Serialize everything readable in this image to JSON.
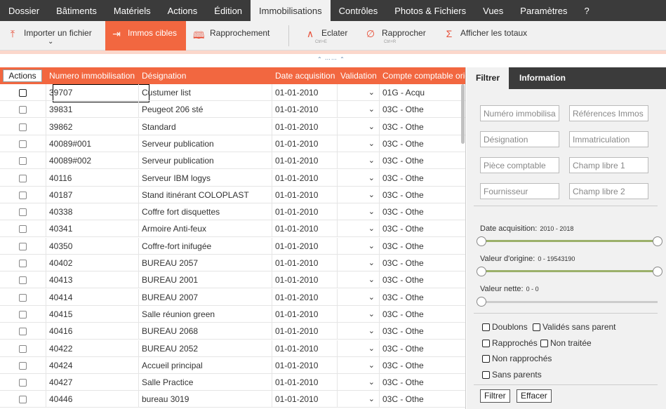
{
  "menu": [
    "Dossier",
    "Bâtiments",
    "Matériels",
    "Actions",
    "Édition",
    "Immobilisations",
    "Contrôles",
    "Photos & Fichiers",
    "Vues",
    "Paramètres",
    "?"
  ],
  "toolbar": {
    "import": "Importer un fichier",
    "immos_cibles": "Immos cibles",
    "rapprochement": "Rapprochement",
    "eclater": "Eclater",
    "eclater_shortcut": "Ctrl+E",
    "rapprocher": "Rapprocher",
    "rapprocher_shortcut": "Ctrl+R",
    "afficher_totaux": "Afficher les totaux"
  },
  "grid": {
    "actions_label": "Actions",
    "headers": {
      "numero": "Numero immobilisation",
      "designation": "Désignation",
      "date": "Date acquisition",
      "validation": "Validation",
      "compte": "Compte comptable orig"
    },
    "rows": [
      {
        "num": "39707",
        "des": "Custumer list",
        "date": "01-01-2010",
        "cpt": "01G - Acqu"
      },
      {
        "num": "39831",
        "des": "Peugeot 206 sté",
        "date": "01-01-2010",
        "cpt": "03C - Othe"
      },
      {
        "num": "39862",
        "des": "Standard",
        "date": "01-01-2010",
        "cpt": "03C - Othe"
      },
      {
        "num": "40089#001",
        "des": "Serveur publication",
        "date": "01-01-2010",
        "cpt": "03C - Othe"
      },
      {
        "num": "40089#002",
        "des": "Serveur publication",
        "date": "01-01-2010",
        "cpt": "03C - Othe"
      },
      {
        "num": "40116",
        "des": "Serveur IBM logys",
        "date": "01-01-2010",
        "cpt": "03C - Othe"
      },
      {
        "num": "40187",
        "des": "Stand itinérant COLOPLAST",
        "date": "01-01-2010",
        "cpt": "03C - Othe"
      },
      {
        "num": "40338",
        "des": "Coffre fort disquettes",
        "date": "01-01-2010",
        "cpt": "03C - Othe"
      },
      {
        "num": "40341",
        "des": "Armoire Anti-feux",
        "date": "01-01-2010",
        "cpt": "03C - Othe"
      },
      {
        "num": "40350",
        "des": "Coffre-fort inifugée",
        "date": "01-01-2010",
        "cpt": "03C - Othe"
      },
      {
        "num": "40402",
        "des": "BUREAU 2057",
        "date": "01-01-2010",
        "cpt": "03C - Othe"
      },
      {
        "num": "40413",
        "des": "BUREAU 2001",
        "date": "01-01-2010",
        "cpt": "03C - Othe"
      },
      {
        "num": "40414",
        "des": "BUREAU 2007",
        "date": "01-01-2010",
        "cpt": "03C - Othe"
      },
      {
        "num": "40415",
        "des": "Salle réunion green",
        "date": "01-01-2010",
        "cpt": "03C - Othe"
      },
      {
        "num": "40416",
        "des": "BUREAU 2068",
        "date": "01-01-2010",
        "cpt": "03C - Othe"
      },
      {
        "num": "40422",
        "des": "BUREAU 2052",
        "date": "01-01-2010",
        "cpt": "03C - Othe"
      },
      {
        "num": "40424",
        "des": "Accueil principal",
        "date": "01-01-2010",
        "cpt": "03C - Othe"
      },
      {
        "num": "40427",
        "des": "Salle Practice",
        "date": "01-01-2010",
        "cpt": "03C - Othe"
      },
      {
        "num": "40446",
        "des": "bureau 3019",
        "date": "01-01-2010",
        "cpt": "03C - Othe"
      }
    ]
  },
  "panel": {
    "tab_filter": "Filtrer",
    "tab_info": "Information",
    "placeholders": {
      "numero": "Numéro immobilisa",
      "references": "Références Immos",
      "designation": "Désignation",
      "immatriculation": "Immatriculation",
      "piece": "Pièce comptable",
      "champ1": "Champ libre 1",
      "fournisseur": "Fournisseur",
      "champ2": "Champ libre 2"
    },
    "date_acq_label": "Date acquisition:",
    "date_acq_range": "2010 - 2018",
    "valeur_origine_label": "Valeur d'origine:",
    "valeur_origine_range": "0 - 19543190",
    "valeur_nette_label": "Valeur nette:",
    "valeur_nette_range": "0 - 0",
    "checks": {
      "doublons": "Doublons",
      "valides_sans_parent": "Validés sans parent",
      "rapproches": "Rapprochés",
      "non_traitee": "Non traitée",
      "non_rapproches": "Non rapprochés",
      "sans_parents": "Sans parents"
    },
    "filtrer_btn": "Filtrer",
    "effacer_btn": "Effacer"
  },
  "colors": {
    "accent": "#f26740",
    "menubar": "#3b3b3b",
    "slider": "#9bb06a"
  },
  "icons": {
    "import": "upload-icon",
    "immos_cibles": "sign-in-icon",
    "rapprochement": "book-icon",
    "eclater": "split-icon",
    "rapprocher": "merge-icon",
    "afficher_totaux": "sigma-icon"
  }
}
